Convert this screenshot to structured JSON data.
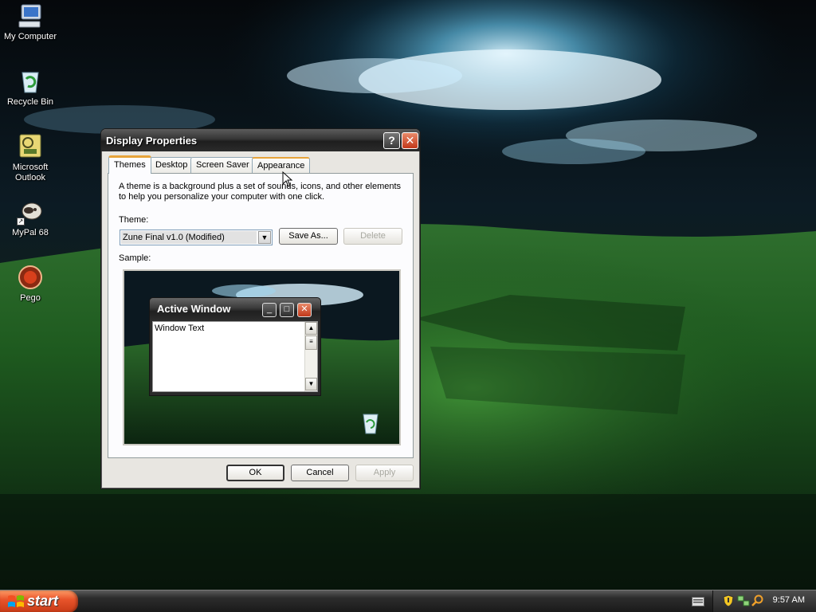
{
  "desktop": {
    "icons": [
      {
        "label": "My Computer",
        "icon": "my-computer-icon"
      },
      {
        "label": "Recycle Bin",
        "icon": "recycle-bin-icon"
      },
      {
        "label": "Microsoft Outlook",
        "label_lines": [
          "Microsoft",
          "Outlook"
        ],
        "icon": "outlook-icon"
      },
      {
        "label": "MyPal 68",
        "icon": "mypal-icon"
      },
      {
        "label": "Pego",
        "icon": "pego-icon"
      }
    ]
  },
  "dialog": {
    "title": "Display Properties",
    "help_glyph": "?",
    "close_glyph": "✕",
    "tabs": [
      {
        "label": "Themes",
        "selected": true
      },
      {
        "label": "Desktop",
        "selected": false
      },
      {
        "label": "Screen Saver",
        "selected": false
      },
      {
        "label": "Appearance",
        "selected": false,
        "hover": true
      }
    ],
    "intro": "A theme is a background plus a set of sounds, icons, and other elements to help you personalize your computer with one click.",
    "theme_label": "Theme:",
    "theme_value": "Zune Final v1.0 (Modified)",
    "save_as_label": "Save As...",
    "delete_label": "Delete",
    "sample_label": "Sample:",
    "sample": {
      "window_title": "Active Window",
      "window_text": "Window Text"
    },
    "ok_label": "OK",
    "cancel_label": "Cancel",
    "apply_label": "Apply"
  },
  "taskbar": {
    "start_label": "start",
    "clock": "9:57 AM"
  },
  "colors": {
    "title_bar": "#2b2b2b",
    "start_button": "#e8542b",
    "close_button": "#c2381a",
    "tab_highlight": "#e7a43b"
  }
}
